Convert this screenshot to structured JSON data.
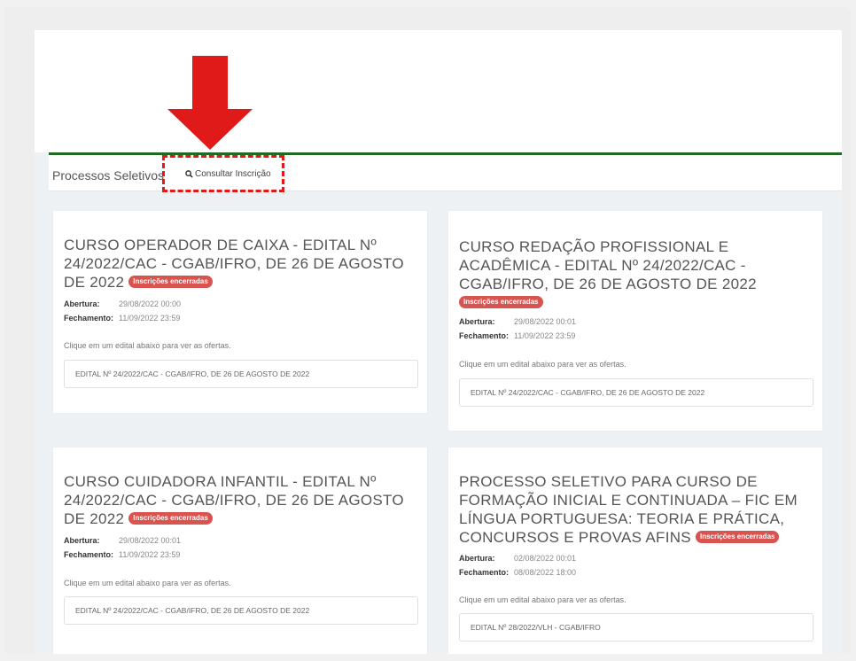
{
  "nav": {
    "processos": "Processos Seletivos",
    "consultar": "Consultar Inscrição"
  },
  "badge_label": "Inscrições encerradas",
  "labels": {
    "abertura": "Abertura:",
    "fechamento": "Fechamento:",
    "hint": "Clique em um edital abaixo para ver as ofertas."
  },
  "cards": [
    {
      "title": "CURSO OPERADOR DE CAIXA - EDITAL Nº 24/2022/CAC - CGAB/IFRO, DE 26 DE AGOSTO DE 2022",
      "abertura": "29/08/2022 00:00",
      "fechamento": "11/09/2022 23:59",
      "edital": "EDITAL Nº 24/2022/CAC - CGAB/IFRO, DE 26 DE AGOSTO DE 2022"
    },
    {
      "title": "CURSO REDAÇÃO PROFISSIONAL E ACADÊMICA - EDITAL Nº 24/2022/CAC - CGAB/IFRO, DE 26 DE AGOSTO DE 2022",
      "abertura": "29/08/2022 00:01",
      "fechamento": "11/09/2022 23:59",
      "edital": "EDITAL Nº 24/2022/CAC - CGAB/IFRO, DE 26 DE AGOSTO DE 2022"
    },
    {
      "title": "CURSO CUIDADORA INFANTIL - EDITAL Nº 24/2022/CAC - CGAB/IFRO, DE 26 DE AGOSTO DE 2022",
      "abertura": "29/08/2022 00:01",
      "fechamento": "11/09/2022 23:59",
      "edital": "EDITAL Nº 24/2022/CAC - CGAB/IFRO, DE 26 DE AGOSTO DE 2022"
    },
    {
      "title": "PROCESSO SELETIVO PARA CURSO DE FORMAÇÃO INICIAL E CONTINUADA – FIC EM LÍNGUA PORTUGUESA: TEORIA E PRÁTICA, CONCURSOS E PROVAS AFINS",
      "abertura": "02/08/2022 00:01",
      "fechamento": "08/08/2022 18:00",
      "edital": "EDITAL Nº 28/2022/VLH - CGAB/IFRO"
    }
  ],
  "colors": {
    "annotation": "#e01919",
    "green_bar": "#1f6b24",
    "badge": "#d9534f"
  },
  "icons": {
    "search": "search-icon",
    "arrow": "arrow-down-icon"
  }
}
